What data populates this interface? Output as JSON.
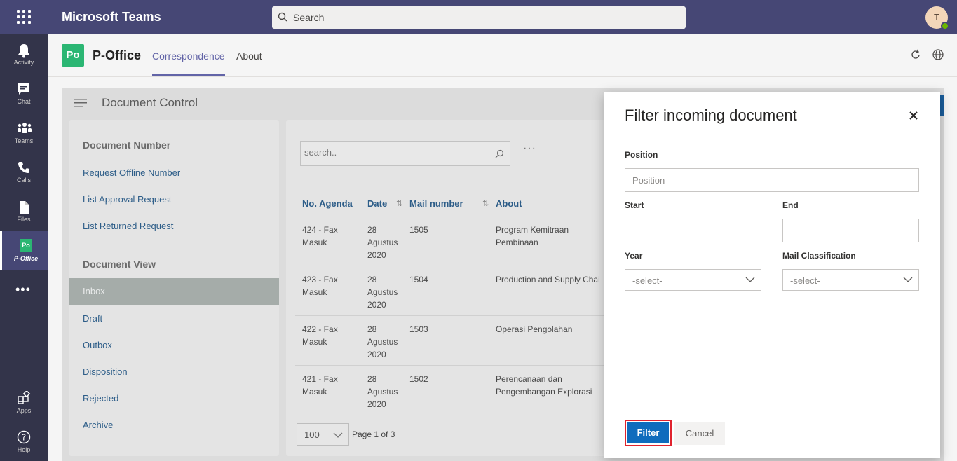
{
  "topbar": {
    "app_title": "Microsoft Teams",
    "search_placeholder": "Search",
    "avatar_initial": "T"
  },
  "rail": {
    "items": [
      {
        "label": "Activity",
        "icon": "bell-icon"
      },
      {
        "label": "Chat",
        "icon": "chat-icon"
      },
      {
        "label": "Teams",
        "icon": "teams-icon"
      },
      {
        "label": "Calls",
        "icon": "phone-icon"
      },
      {
        "label": "Files",
        "icon": "file-icon"
      },
      {
        "label": "P-Office",
        "icon": "p-office-icon"
      },
      {
        "label": "Apps",
        "icon": "apps-icon"
      },
      {
        "label": "Help",
        "icon": "help-icon"
      }
    ],
    "more": "•••"
  },
  "app_header": {
    "logo_text": "Po",
    "app_name": "P-Office",
    "tabs": [
      {
        "label": "Correspondence",
        "active": true
      },
      {
        "label": "About",
        "active": false
      }
    ]
  },
  "page": {
    "title": "Document Control"
  },
  "left_nav": {
    "doc_number_title": "Document Number",
    "doc_number_items": [
      "Request Offline Number",
      "List Approval Request",
      "List Returned Request"
    ],
    "doc_view_title": "Document View",
    "doc_view_items": [
      "Inbox",
      "Draft",
      "Outbox",
      "Disposition",
      "Rejected",
      "Archive"
    ],
    "selected": "Inbox"
  },
  "list": {
    "search_placeholder": "search..",
    "more": "···",
    "columns": [
      "No. Agenda",
      "Date",
      "Mail number",
      "About"
    ],
    "rows": [
      {
        "agenda": [
          "424 - Fax",
          "Masuk"
        ],
        "date": [
          "28",
          "Agustus",
          "2020"
        ],
        "mail_number": "1505",
        "about": [
          "Program Kemitraan",
          "Pembinaan"
        ]
      },
      {
        "agenda": [
          "423 - Fax",
          "Masuk"
        ],
        "date": [
          "28",
          "Agustus",
          "2020"
        ],
        "mail_number": "1504",
        "about": [
          "Production and Supply Chai",
          ""
        ]
      },
      {
        "agenda": [
          "422 - Fax",
          "Masuk"
        ],
        "date": [
          "28",
          "Agustus",
          "2020"
        ],
        "mail_number": "1503",
        "about": [
          "Operasi Pengolahan",
          ""
        ]
      },
      {
        "agenda": [
          "421 - Fax",
          "Masuk"
        ],
        "date": [
          "28",
          "Agustus",
          "2020"
        ],
        "mail_number": "1502",
        "about": [
          "Perencanaan dan",
          "Pengembangan Explorasi"
        ]
      }
    ],
    "page_size": "100",
    "page_info": "Page 1 of 3"
  },
  "dialog": {
    "title": "Filter incoming document",
    "position_label": "Position",
    "position_placeholder": "Position",
    "start_label": "Start",
    "end_label": "End",
    "year_label": "Year",
    "year_value": "-select-",
    "mail_class_label": "Mail Classification",
    "mail_class_value": "-select-",
    "filter_button": "Filter",
    "cancel_button": "Cancel"
  },
  "colors": {
    "teams_purple": "#464775",
    "rail_bg": "#33344a",
    "accent": "#6264a7",
    "primary_button": "#0f6cbd",
    "highlight_border": "#e0232e",
    "p_office_green": "#2bb673"
  }
}
